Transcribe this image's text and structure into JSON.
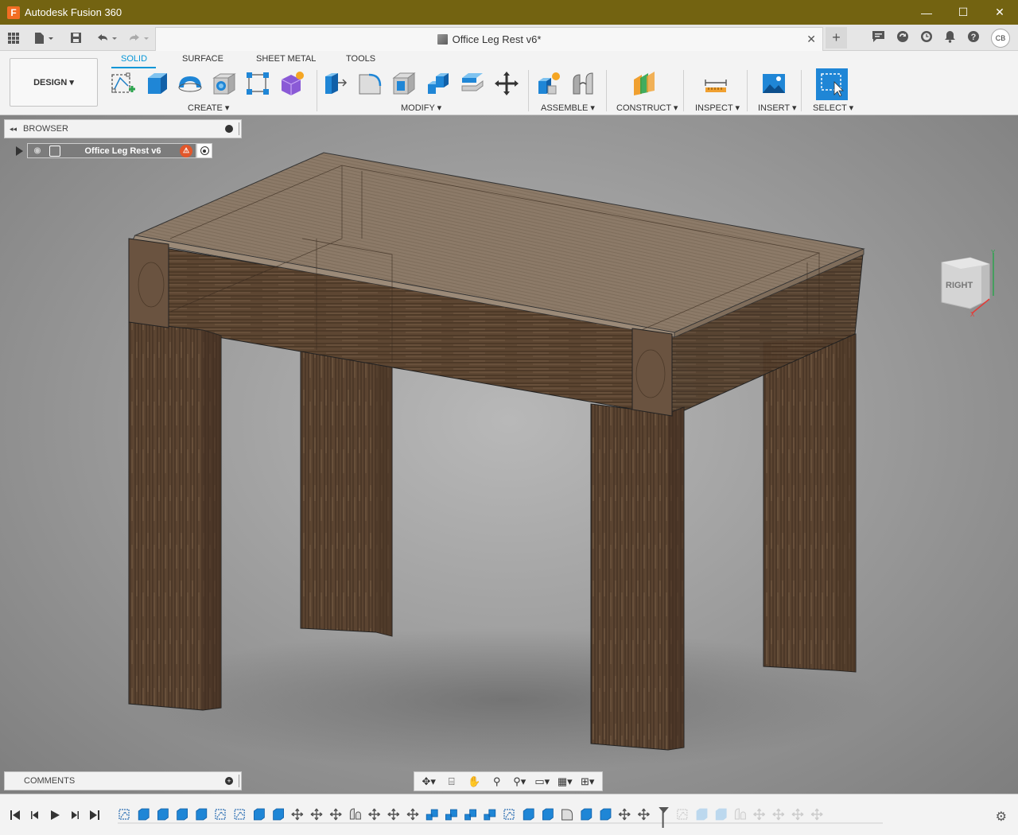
{
  "app": {
    "title": "Autodesk Fusion 360",
    "logo_letter": "F"
  },
  "window_controls": {
    "minimize": "—",
    "maximize": "☐",
    "close": "✕"
  },
  "document": {
    "tab_title": "Office Leg Rest v6*"
  },
  "user": {
    "initials": "CB"
  },
  "workspace": {
    "label": "DESIGN ▾"
  },
  "toolbar_tabs": [
    "SOLID",
    "SURFACE",
    "SHEET METAL",
    "TOOLS"
  ],
  "groups": {
    "create": "CREATE ▾",
    "modify": "MODIFY ▾",
    "assemble": "ASSEMBLE ▾",
    "construct": "CONSTRUCT ▾",
    "inspect": "INSPECT ▾",
    "insert": "INSERT ▾",
    "select": "SELECT ▾"
  },
  "browser": {
    "title": "BROWSER",
    "root_item": "Office Leg Rest v6"
  },
  "comments": {
    "title": "COMMENTS"
  },
  "viewcube": {
    "face": "RIGHT"
  },
  "colors": {
    "accent": "#0696d7",
    "titlebar": "#736311",
    "wood": "#5a4430",
    "wood_top": "#8b7763"
  },
  "timeline": {
    "features": [
      "sketch",
      "extrude",
      "extrude",
      "extrude",
      "extrude",
      "sketch",
      "sketch",
      "extrude",
      "extrude",
      "move",
      "move",
      "move",
      "joint",
      "move",
      "move",
      "move",
      "combine",
      "combine",
      "combine",
      "combine",
      "sketch",
      "extrude",
      "extrude",
      "fillet",
      "extrude",
      "extrude",
      "move",
      "move",
      "marker",
      "sketch",
      "extrude",
      "extrude",
      "joint",
      "move",
      "move",
      "move",
      "move"
    ]
  }
}
